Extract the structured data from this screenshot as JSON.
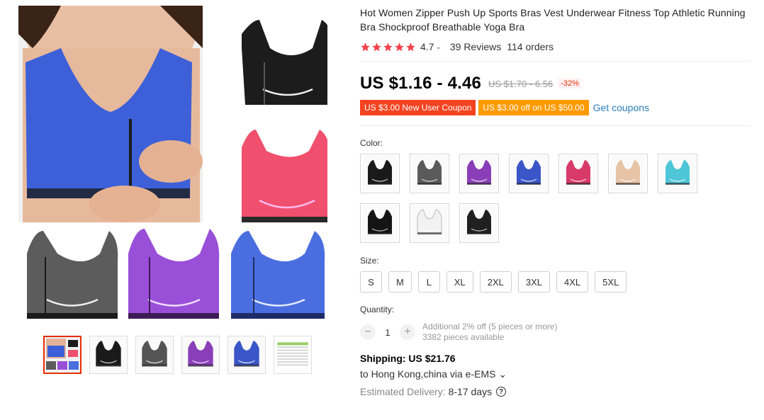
{
  "product": {
    "title": "Hot Women Zipper Push Up Sports Bras Vest Underwear Fitness Top Athletic Running Bra Shockproof Breathable Yoga Bra",
    "rating": "4.7",
    "rating_chevron": "⌄",
    "reviews": "39 Reviews",
    "orders": "114 orders",
    "stars": 5
  },
  "price": {
    "current": "US $1.16 - 4.46",
    "original": "US $1.70 - 6.56",
    "discount": "-32%"
  },
  "coupons": {
    "new_user": "US $3.00 New User Coupon",
    "off": "US $3.00 off on US $50.00",
    "get": "Get coupons"
  },
  "color": {
    "label": "Color:",
    "swatches": [
      {
        "name": "black",
        "color": "#1a1a1a"
      },
      {
        "name": "gray",
        "color": "#5a5a5a"
      },
      {
        "name": "purple",
        "color": "#8a3fb8"
      },
      {
        "name": "blue",
        "color": "#3a56c8"
      },
      {
        "name": "rose",
        "color": "#d83a6a"
      },
      {
        "name": "nude",
        "color": "#e8c4a6"
      },
      {
        "name": "sky-blue",
        "color": "#4fc6d8"
      },
      {
        "name": "black-strap",
        "color": "#151515"
      },
      {
        "name": "white-strap",
        "color": "#f2f2f2"
      },
      {
        "name": "black-cross",
        "color": "#202020"
      }
    ]
  },
  "size": {
    "label": "Size:",
    "options": [
      "S",
      "M",
      "L",
      "XL",
      "2XL",
      "3XL",
      "4XL",
      "5XL"
    ]
  },
  "quantity": {
    "label": "Quantity:",
    "value": "1",
    "minus": "−",
    "plus": "+",
    "additional": "Additional 2% off (5 pieces or more)",
    "available": "3382 pieces available"
  },
  "shipping": {
    "title": "Shipping: US $21.76",
    "destination": "to Hong Kong,china via e-EMS ⌄",
    "delivery_label": "Estimated Delivery:",
    "delivery_days": "8-17 days",
    "help": "?"
  },
  "gallery": {
    "main_colors": [
      "#3a5bd6",
      "#1c1c1c",
      "#f0506e",
      "#5c5c5c",
      "#9a4fd8",
      "#4a6ee0"
    ],
    "thumbs": [
      {
        "name": "collage",
        "color": "#3a5bd6"
      },
      {
        "name": "black",
        "color": "#1a1a1a"
      },
      {
        "name": "gray",
        "color": "#555555"
      },
      {
        "name": "purple",
        "color": "#8a3fb8"
      },
      {
        "name": "blue",
        "color": "#3a56c8"
      },
      {
        "name": "size-chart",
        "color": "#dcdcdc"
      }
    ]
  }
}
